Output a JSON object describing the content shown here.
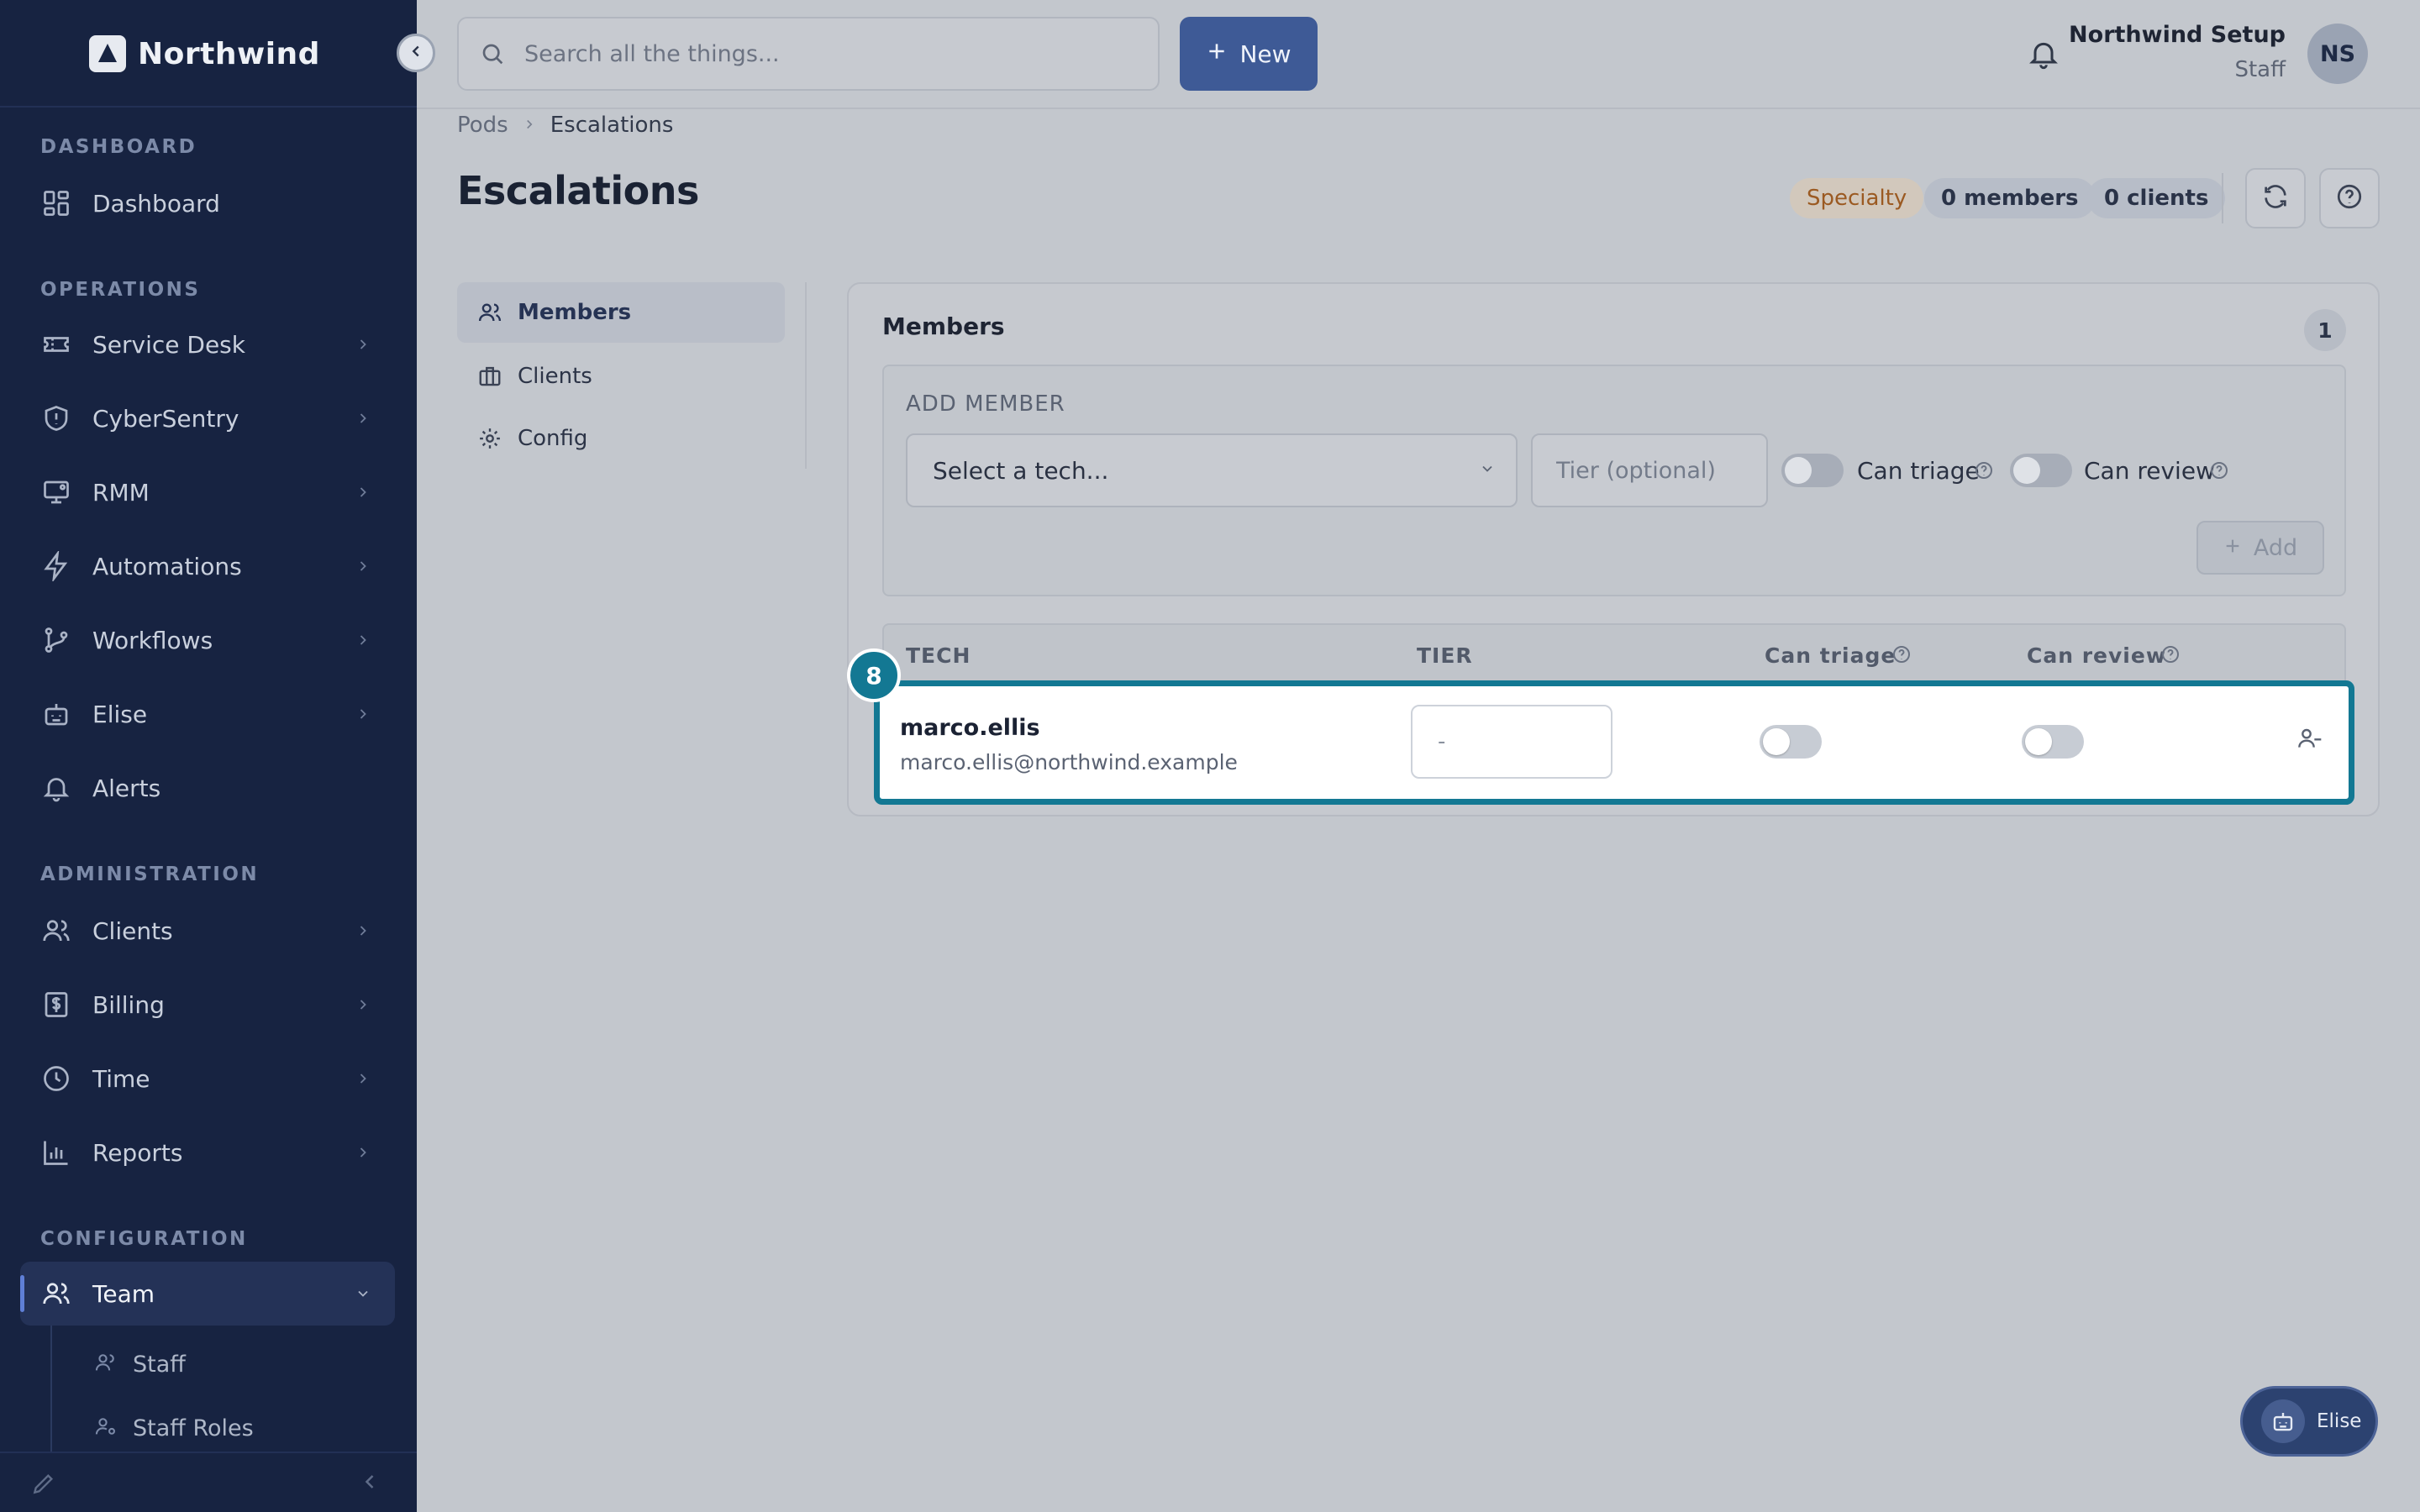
{
  "brand": {
    "name": "Northwind"
  },
  "sidebar": {
    "sections": {
      "dashboard": "DASHBOARD",
      "operations": "OPERATIONS",
      "administration": "ADMINISTRATION",
      "configuration": "CONFIGURATION"
    },
    "items": [
      {
        "label": "Dashboard",
        "icon": "grid-icon"
      },
      {
        "label": "Service Desk",
        "icon": "ticket-icon"
      },
      {
        "label": "CyberSentry",
        "icon": "shield-icon"
      },
      {
        "label": "RMM",
        "icon": "monitor-icon"
      },
      {
        "label": "Automations",
        "icon": "bolt-icon"
      },
      {
        "label": "Workflows",
        "icon": "branch-icon"
      },
      {
        "label": "Elise",
        "icon": "bot-icon"
      },
      {
        "label": "Alerts",
        "icon": "bell-icon"
      },
      {
        "label": "Clients",
        "icon": "users-icon"
      },
      {
        "label": "Billing",
        "icon": "dollar-icon"
      },
      {
        "label": "Time",
        "icon": "clock-icon"
      },
      {
        "label": "Reports",
        "icon": "chart-icon"
      },
      {
        "label": "Team",
        "icon": "users-icon"
      }
    ],
    "sub_items": [
      {
        "label": "Staff",
        "icon": "user-icon"
      },
      {
        "label": "Staff Roles",
        "icon": "user-cog-icon"
      }
    ]
  },
  "topbar": {
    "search_placeholder": "Search all the things...",
    "new_label": "New",
    "user_name": "Northwind Setup",
    "user_role": "Staff",
    "avatar_initials": "NS"
  },
  "breadcrumb": {
    "parent": "Pods",
    "current": "Escalations"
  },
  "page": {
    "title": "Escalations",
    "pills": {
      "specialty": "Specialty",
      "members": "0 members",
      "clients": "0 clients"
    }
  },
  "tabs": [
    {
      "label": "Members",
      "icon": "users-icon"
    },
    {
      "label": "Clients",
      "icon": "briefcase-icon"
    },
    {
      "label": "Config",
      "icon": "gear-icon"
    }
  ],
  "members_card": {
    "title": "Members",
    "count": "1",
    "add_member": {
      "label": "ADD MEMBER",
      "select_placeholder": "Select a tech...",
      "tier_placeholder": "Tier (optional)",
      "can_triage_label": "Can triage",
      "can_review_label": "Can review",
      "add_button": "Add"
    },
    "columns": {
      "tech": "TECH",
      "tier": "TIER",
      "can_triage": "Can triage",
      "can_review": "Can review"
    },
    "rows": [
      {
        "name": "marco.ellis",
        "email": "marco.ellis@northwind.example",
        "tier_placeholder": "-",
        "can_triage": false,
        "can_review": false
      }
    ],
    "highlight_badge": "8"
  },
  "elise_button": {
    "label": "Elise"
  },
  "colors": {
    "sidebar_bg": "#172341",
    "accent": "#3e5a96",
    "highlight": "#137893",
    "specialty": "#9b5a22"
  }
}
